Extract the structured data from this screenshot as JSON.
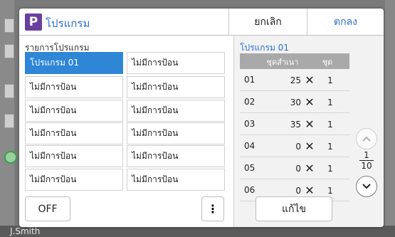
{
  "background": {
    "user_name": "J.Smith"
  },
  "dialog": {
    "icon_letter": "P",
    "title": "โปรแกรม",
    "cancel_label": "ยกเลิก",
    "ok_label": "ตกลง"
  },
  "program_list": {
    "label": "รายการโปรแกรม",
    "left_column": [
      "โปรแกรม 01",
      "ไม่มีการป้อน",
      "ไม่มีการป้อน",
      "ไม่มีการป้อน",
      "ไม่มีการป้อน",
      "ไม่มีการป้อน"
    ],
    "right_column": [
      "ไม่มีการป้อน",
      "ไม่มีการป้อน",
      "ไม่มีการป้อน",
      "ไม่มีการป้อน",
      "ไม่มีการป้อน",
      "ไม่มีการป้อน"
    ],
    "selected_index": 0
  },
  "off_label": "OFF",
  "more_label": "⋮",
  "detail": {
    "title": "โปรแกรม 01",
    "header_copies": "ชุดสำเนา",
    "header_sets": "ชุด",
    "rows": [
      {
        "idx": "01",
        "copies": "25",
        "x": "✕",
        "sets": "1"
      },
      {
        "idx": "02",
        "copies": "30",
        "x": "✕",
        "sets": "1"
      },
      {
        "idx": "03",
        "copies": "35",
        "x": "✕",
        "sets": "1"
      },
      {
        "idx": "04",
        "copies": "0",
        "x": "✕",
        "sets": "1"
      },
      {
        "idx": "05",
        "copies": "0",
        "x": "✕",
        "sets": "1"
      },
      {
        "idx": "06",
        "copies": "0",
        "x": "✕",
        "sets": "1"
      }
    ],
    "page_current": "1",
    "page_total": "10",
    "edit_label": "แก้ไข"
  },
  "icons": {
    "up": "chevron-up-icon",
    "down": "chevron-down-icon"
  },
  "colors": {
    "accent": "#2a6fcf",
    "selected": "#2f86d6",
    "app_icon": "#6a3fa0"
  }
}
